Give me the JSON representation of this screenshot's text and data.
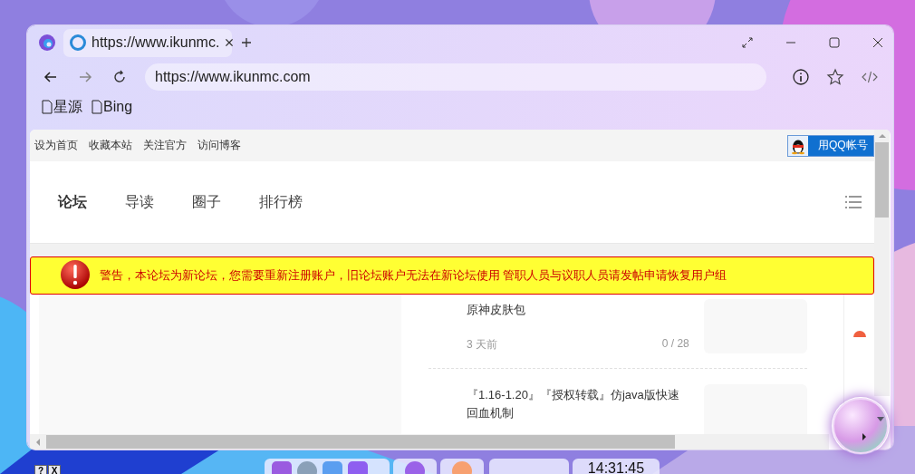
{
  "browser": {
    "tabs": [
      {
        "title": "https://www.ikunmc.",
        "selected": true
      }
    ],
    "address": "https://www.ikunmc.com",
    "bookmarks": [
      {
        "label": "星源"
      },
      {
        "label": "Bing"
      }
    ]
  },
  "page": {
    "top_links": [
      "设为首页",
      "收藏本站",
      "关注官方",
      "访问博客"
    ],
    "qq_login": "用QQ帐号",
    "nav": [
      {
        "label": "论坛",
        "selected": true
      },
      {
        "label": "导读",
        "selected": false
      },
      {
        "label": "圈子",
        "selected": false
      },
      {
        "label": "排行榜",
        "selected": false
      }
    ],
    "alert": "警告，本论坛为新论坛，您需要重新注册账户，旧论坛账户无法在新论坛使用 管职人员与议职人员请发帖申请恢复用户组",
    "posts": [
      {
        "title": "原神皮肤包",
        "time": "3 天前",
        "stats": "0 / 28"
      },
      {
        "title": "『1.16-1.20』『授权转载』仿java版快速回血机制"
      }
    ]
  },
  "desktop_widget": {
    "buttons": [
      "?",
      "X"
    ]
  },
  "taskbar": {
    "clock": "14:31:45"
  }
}
